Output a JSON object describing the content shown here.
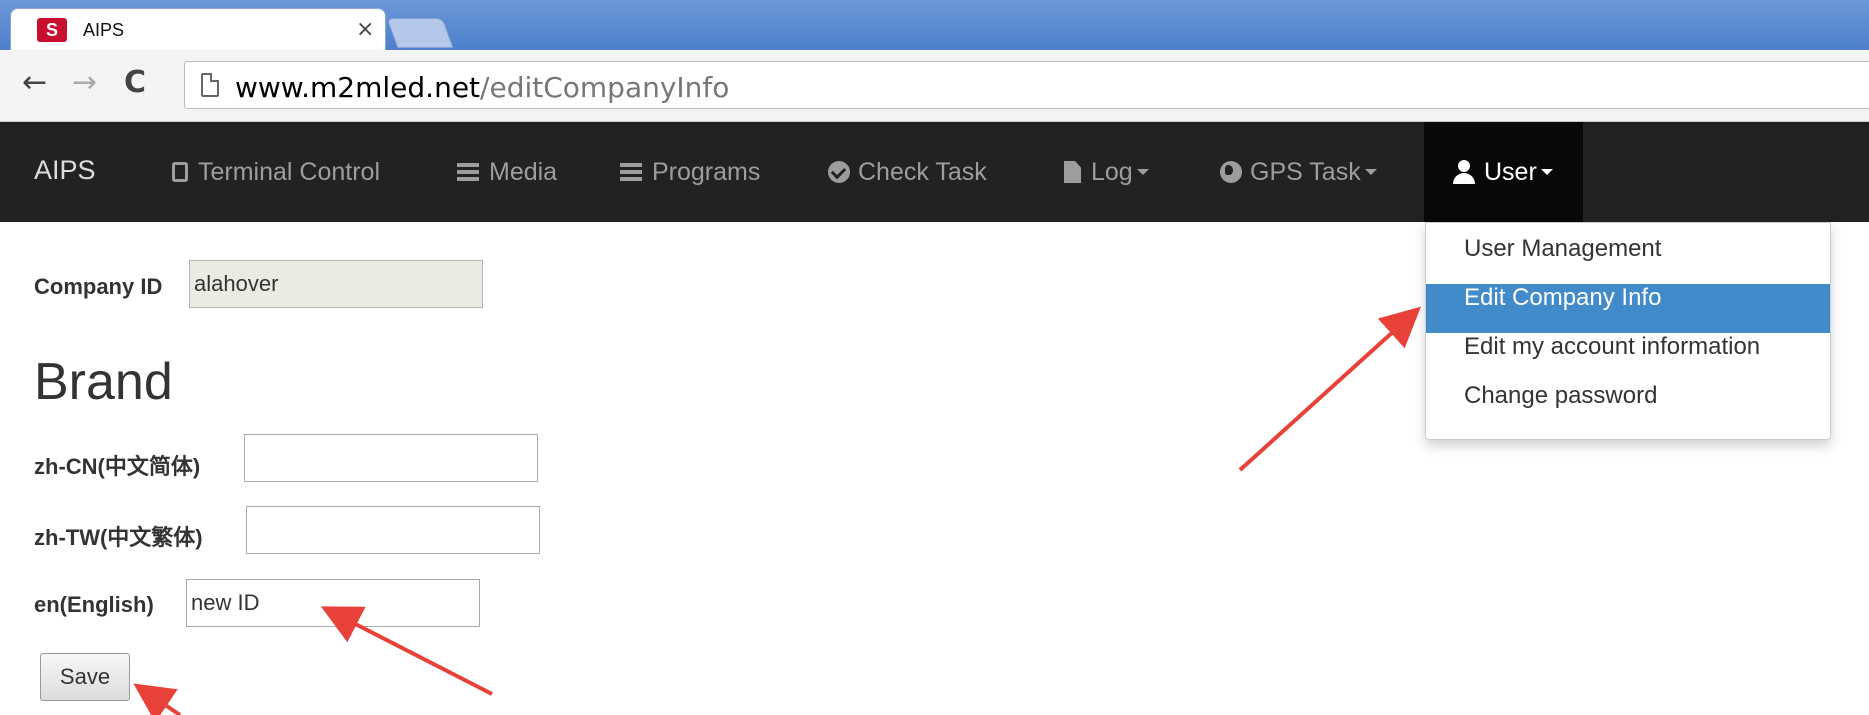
{
  "browser": {
    "tab_title": "AIPS",
    "tab_close": "×",
    "favicon_letter": "S",
    "url_host": "www.m2mled.net",
    "url_path": "/editCompanyInfo"
  },
  "navbar": {
    "brand": "AIPS",
    "items": [
      {
        "label": "Terminal Control",
        "icon": "tablet-icon"
      },
      {
        "label": "Media",
        "icon": "hdd-icon"
      },
      {
        "label": "Programs",
        "icon": "list-icon"
      },
      {
        "label": "Check Task",
        "icon": "check-circle-icon"
      },
      {
        "label": "Log",
        "icon": "file-icon",
        "dropdown": true
      },
      {
        "label": "GPS Task",
        "icon": "globe-icon",
        "dropdown": true
      },
      {
        "label": "User",
        "icon": "user-icon",
        "dropdown": true,
        "open": true
      }
    ]
  },
  "user_menu": {
    "items": [
      {
        "label": "User Management"
      },
      {
        "label": "Edit Company Info",
        "active": true
      },
      {
        "label": "Edit my account information"
      },
      {
        "label": "Change password"
      }
    ]
  },
  "form": {
    "company_id_label": "Company ID",
    "company_id_value": "alahover",
    "brand_heading": "Brand",
    "zh_cn_label": "zh-CN(中文简体)",
    "zh_cn_value": "",
    "zh_tw_label": "zh-TW(中文繁体)",
    "zh_tw_value": "",
    "en_label": "en(English)",
    "en_value": "new ID",
    "save_label": "Save"
  },
  "colors": {
    "navbar_bg": "#222222",
    "active_menu_bg": "#428bca",
    "annotation_arrow": "#e8413a"
  }
}
